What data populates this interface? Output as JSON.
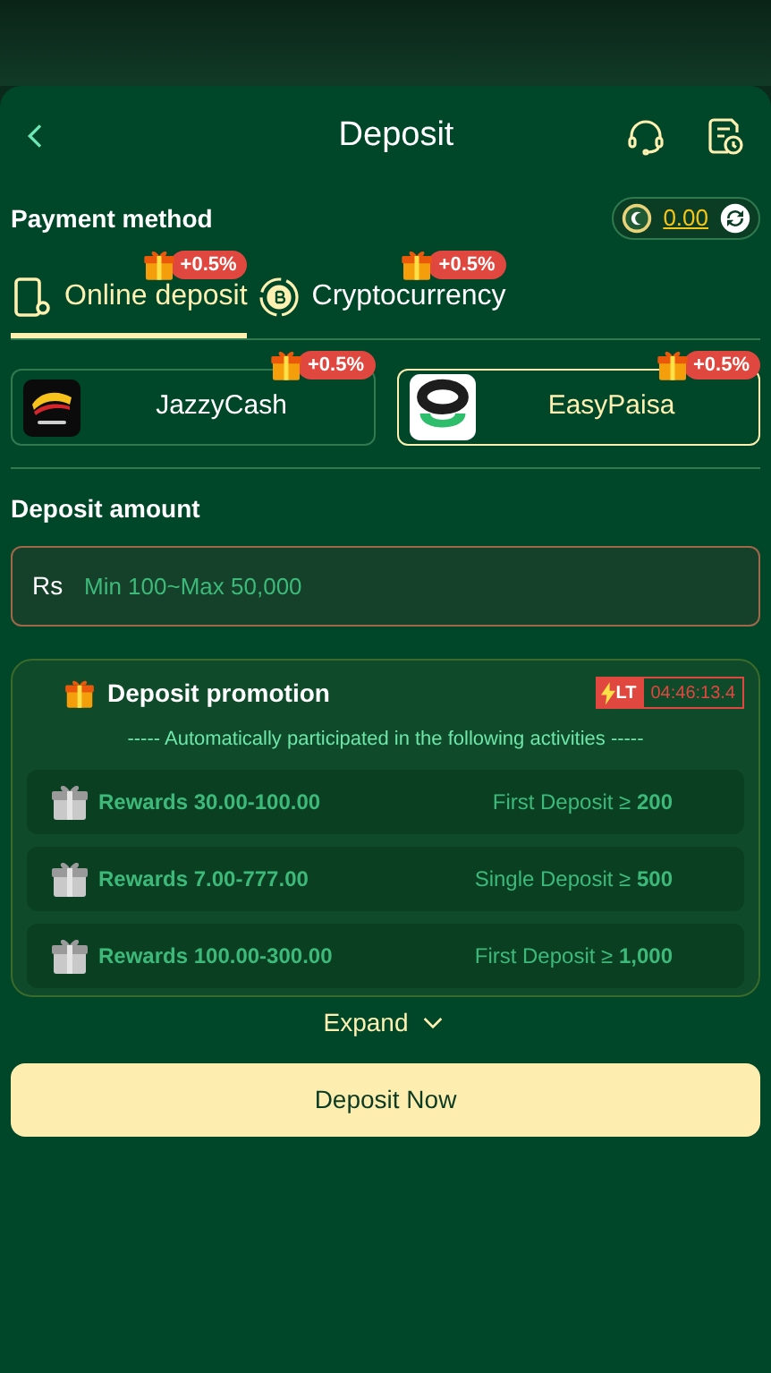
{
  "header": {
    "title": "Deposit"
  },
  "payment": {
    "label": "Payment method",
    "balance": "0.00"
  },
  "tabs": [
    {
      "label": "Online deposit",
      "bonus": "+0.5%",
      "selected": true,
      "kind": "phone"
    },
    {
      "label": "Cryptocurrency",
      "bonus": "+0.5%",
      "selected": false,
      "kind": "coin"
    }
  ],
  "channels": [
    {
      "name": "JazzyCash",
      "bonus": "+0.5%",
      "selected": false,
      "kind": "jazz"
    },
    {
      "name": "EasyPaisa",
      "bonus": "+0.5%",
      "selected": true,
      "kind": "easy"
    }
  ],
  "amount": {
    "label": "Deposit amount",
    "currency": "Rs",
    "placeholder": "Min 100~Max 50,000"
  },
  "promotion": {
    "title": "Deposit promotion",
    "badge": "LT",
    "timer": "04:46:13.4",
    "subtitle": "----- Automatically participated in the following activities -----",
    "rewards": [
      {
        "reward": "Rewards 30.00-100.00",
        "condition": "First Deposit ≥ **200**"
      },
      {
        "reward": "Rewards 7.00-777.00",
        "condition": "Single Deposit ≥ **500**"
      },
      {
        "reward": "Rewards 100.00-300.00",
        "condition": "First Deposit ≥ **1,000**"
      }
    ]
  },
  "expand": "Expand",
  "submit": "Deposit Now"
}
